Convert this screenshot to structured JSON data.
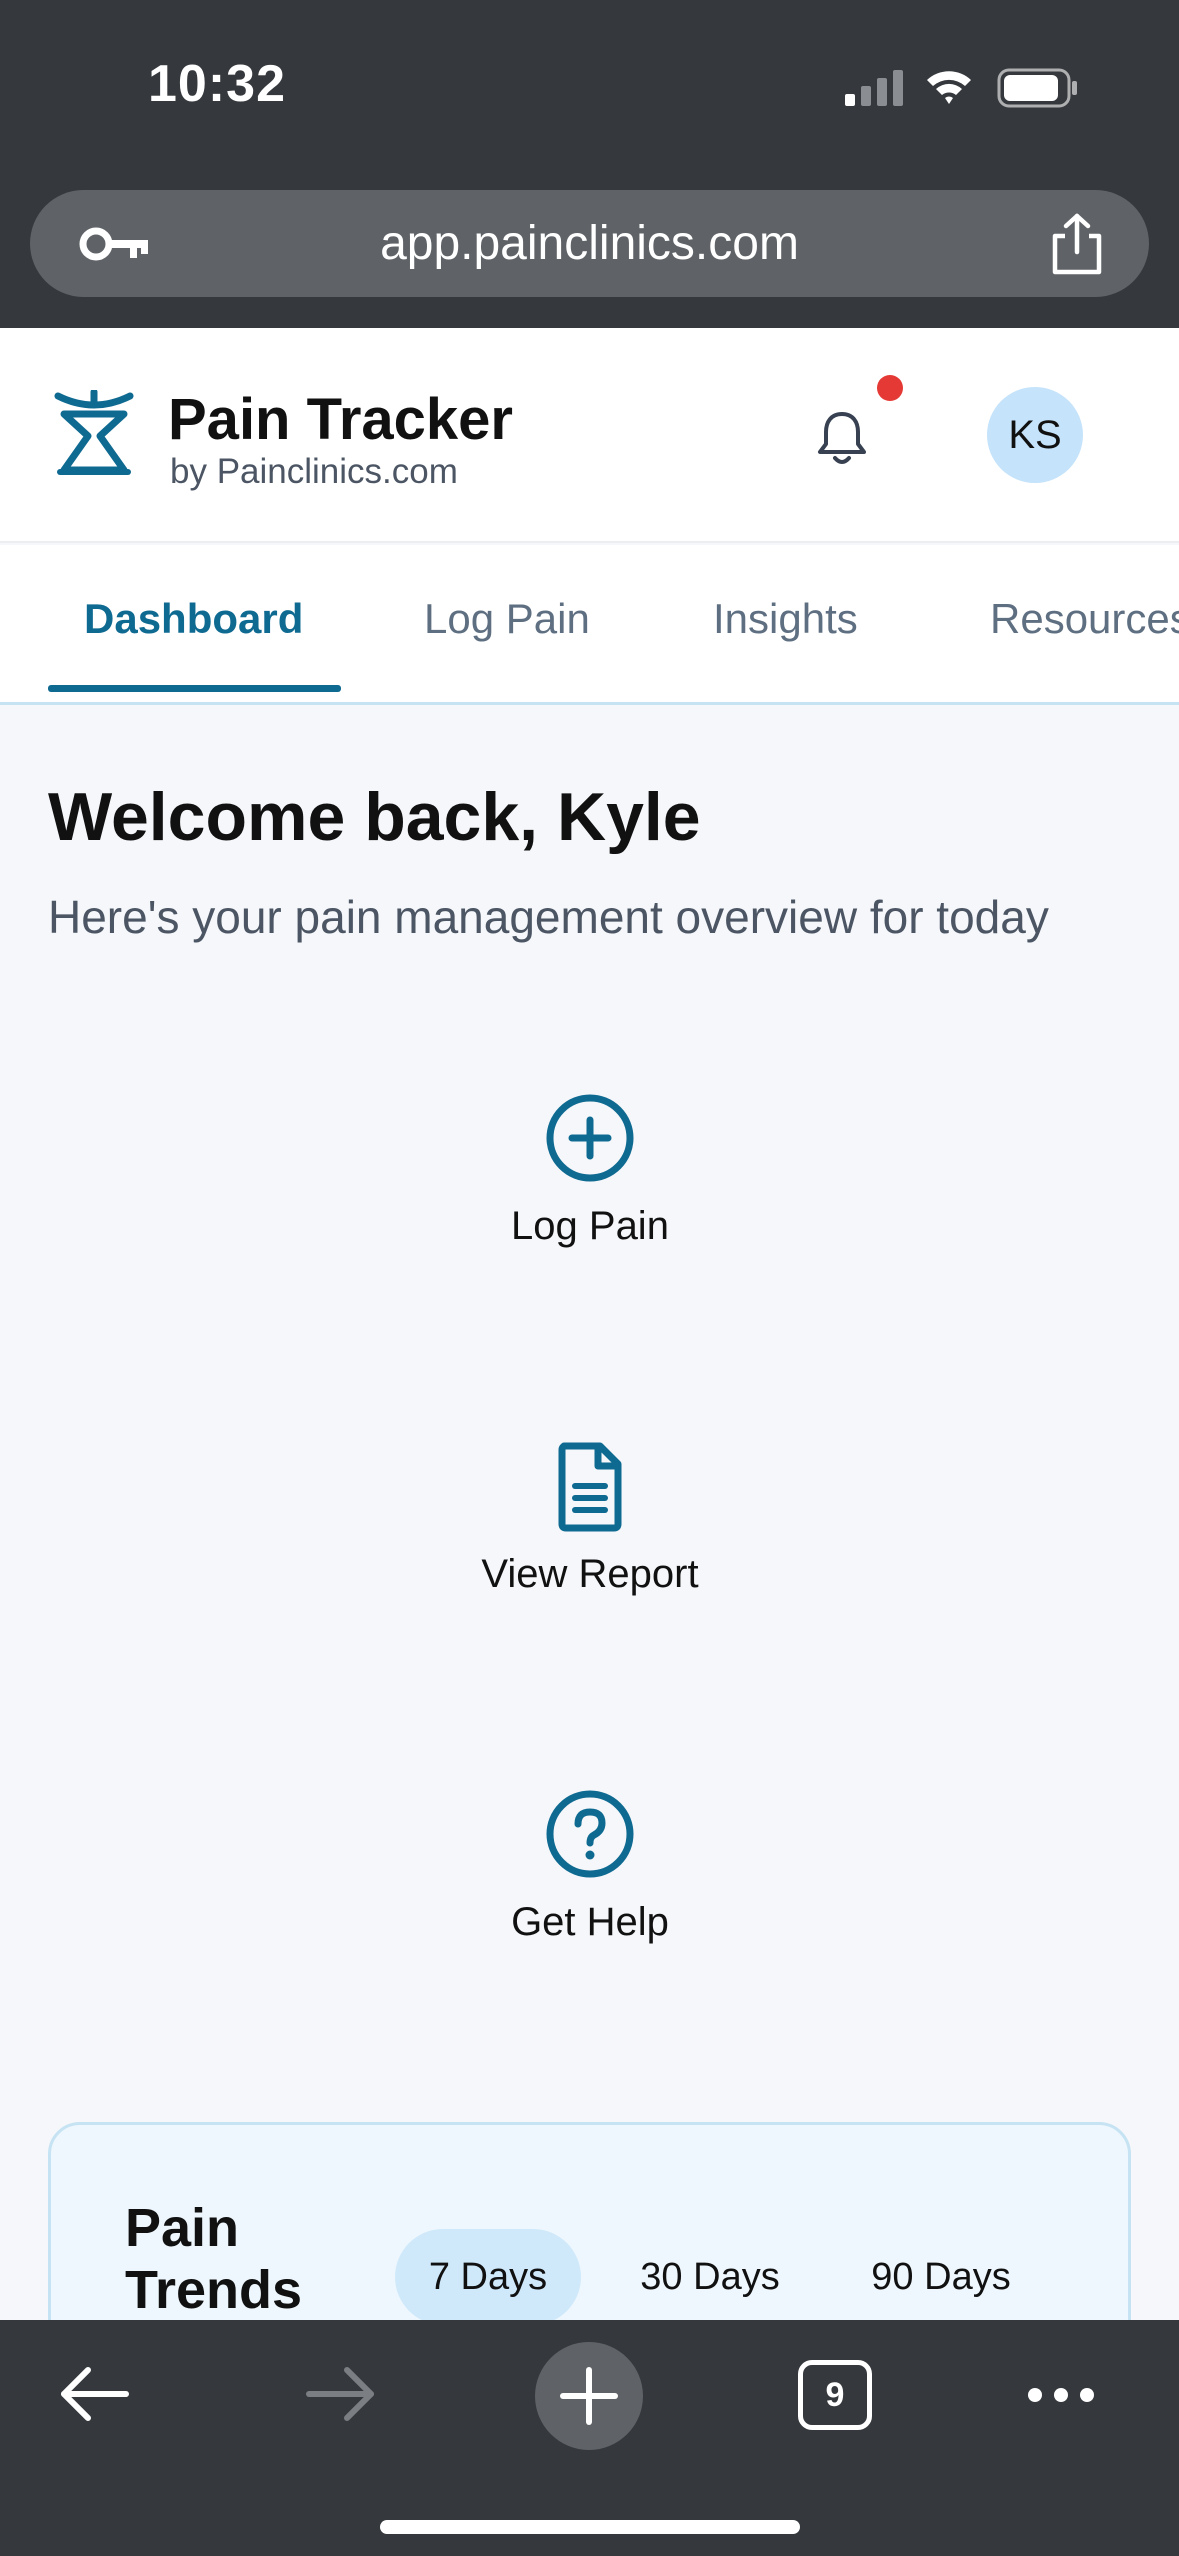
{
  "status_bar": {
    "time": "10:32"
  },
  "browser": {
    "url": "app.painclinics.com",
    "tab_count": "9"
  },
  "app": {
    "title": "Pain Tracker",
    "subtitle": "by Painclinics.com",
    "user_initials": "KS"
  },
  "tabs": [
    {
      "label": "Dashboard",
      "active": true
    },
    {
      "label": "Log Pain",
      "active": false
    },
    {
      "label": "Insights",
      "active": false
    },
    {
      "label": "Resources",
      "active": false
    }
  ],
  "main": {
    "welcome": "Welcome back, Kyle",
    "overview": "Here's your pain management overview for today",
    "actions": [
      {
        "label": "Log Pain",
        "icon": "plus-circle-icon"
      },
      {
        "label": "View Report",
        "icon": "document-icon"
      },
      {
        "label": "Get Help",
        "icon": "question-circle-icon"
      }
    ]
  },
  "trends": {
    "title": "Pain Trends",
    "ranges": [
      {
        "label": "7 Days",
        "active": true
      },
      {
        "label": "30 Days",
        "active": false
      },
      {
        "label": "90 Days",
        "active": false
      }
    ]
  },
  "colors": {
    "accent": "#0f6a91",
    "chrome": "#35383c",
    "notification": "#e53935",
    "avatar_bg": "#c5e3fa"
  }
}
